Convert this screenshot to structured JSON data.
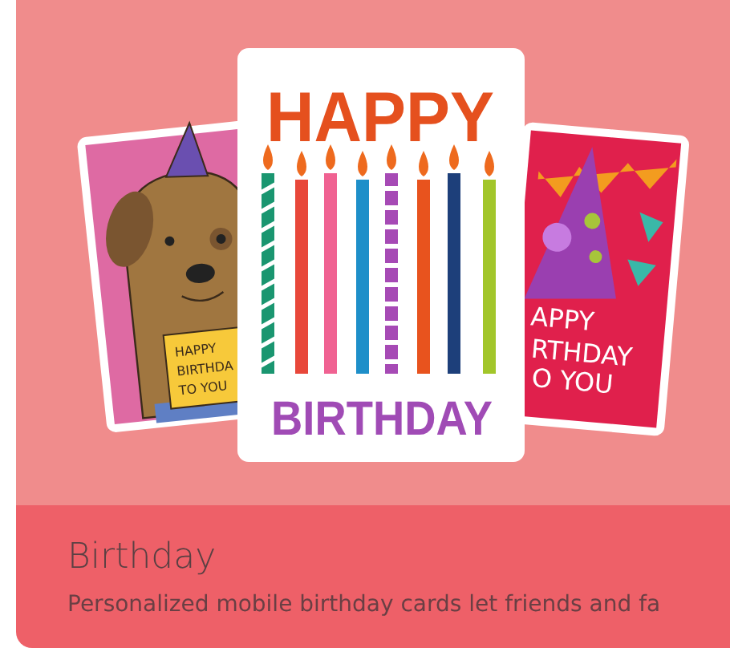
{
  "card": {
    "title": "Birthday",
    "description": "Personalized mobile birthday cards let friends and fa",
    "illustration": {
      "left_card": {
        "lines": [
          "HAPPY",
          "BIRTHDA",
          "TO YOU"
        ]
      },
      "center_card": {
        "line_1": "HAPPY",
        "line_2": "BIRTHDAY"
      },
      "right_card": {
        "lines": [
          "APPY",
          "RTHDAY",
          "O YOU"
        ]
      }
    }
  }
}
